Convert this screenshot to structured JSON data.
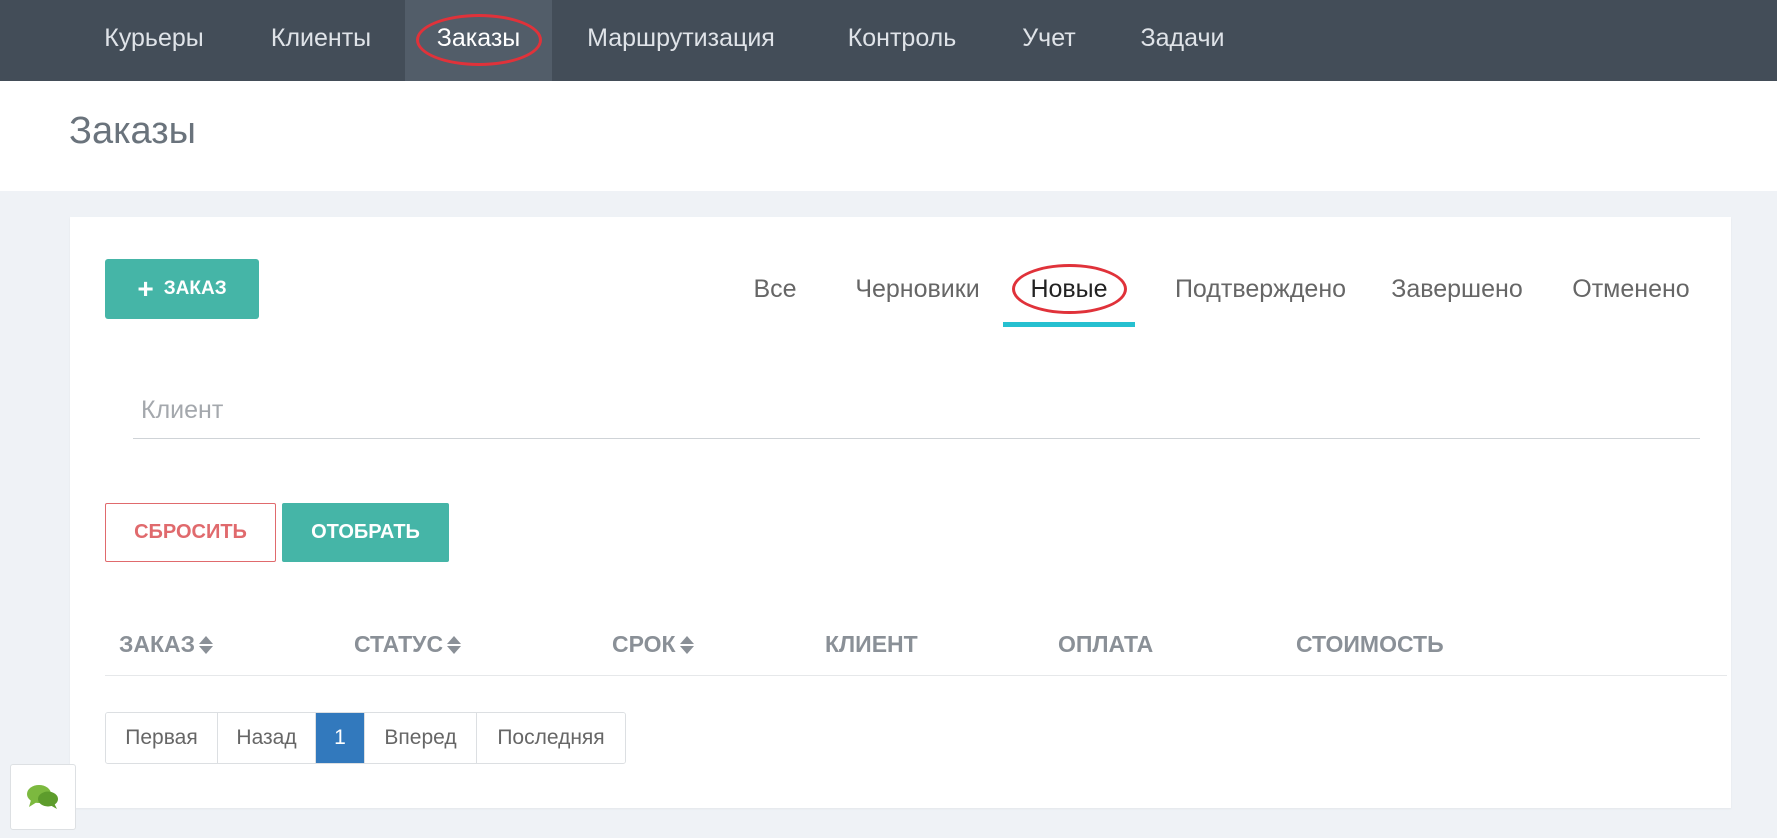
{
  "nav": {
    "items": [
      {
        "label": "Курьеры"
      },
      {
        "label": "Клиенты"
      },
      {
        "label": "Заказы"
      },
      {
        "label": "Маршрутизация"
      },
      {
        "label": "Контроль"
      },
      {
        "label": "Учет"
      },
      {
        "label": "Задачи"
      }
    ],
    "active_index": 2
  },
  "page": {
    "title": "Заказы"
  },
  "toolbar": {
    "add_label": "ЗАКАЗ",
    "add_icon": "plus-icon"
  },
  "tabs": {
    "items": [
      {
        "label": "Все"
      },
      {
        "label": "Черновики"
      },
      {
        "label": "Новые"
      },
      {
        "label": "Подтверждено"
      },
      {
        "label": "Завершено"
      },
      {
        "label": "Отменено"
      }
    ],
    "active_index": 2
  },
  "filter": {
    "client_placeholder": "Клиент",
    "client_value": "",
    "reset_label": "СБРОСИТЬ",
    "apply_label": "ОТОБРАТЬ"
  },
  "table": {
    "columns": [
      {
        "label": "ЗАКАЗ",
        "sortable": true
      },
      {
        "label": "СТАТУС",
        "sortable": true
      },
      {
        "label": "СРОК",
        "sortable": true
      },
      {
        "label": "КЛИЕНТ",
        "sortable": false
      },
      {
        "label": "ОПЛАТА",
        "sortable": false
      },
      {
        "label": "СТОИМОСТЬ",
        "sortable": false
      }
    ],
    "rows": []
  },
  "pagination": {
    "first": "Первая",
    "prev": "Назад",
    "current": "1",
    "next": "Вперед",
    "last": "Последняя"
  },
  "colors": {
    "nav_bg": "#434d58",
    "accent": "#45b5a7",
    "tab_underline": "#26c0d0",
    "danger": "#e06a6d",
    "pager_active": "#3279bd",
    "highlight_circle": "#e0323a"
  },
  "chat": {
    "icon": "chat-bubbles-icon"
  }
}
